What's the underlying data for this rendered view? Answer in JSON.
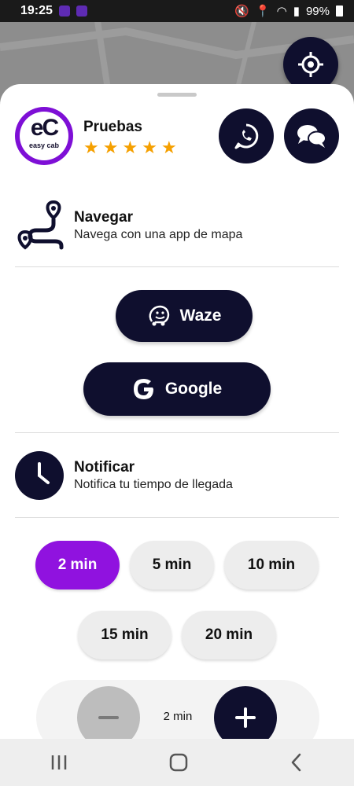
{
  "status_bar": {
    "time": "19:25",
    "battery": "99%"
  },
  "driver": {
    "name": "Pruebas",
    "rating": 5,
    "stars": [
      "★",
      "★",
      "★",
      "★",
      "★"
    ]
  },
  "logo": {
    "initials": "eC",
    "subtitle": "easy cab"
  },
  "navigate": {
    "title": "Navegar",
    "subtitle": "Navega con una app de mapa",
    "waze_label": "Waze",
    "google_label": "Google"
  },
  "notify": {
    "title": "Notificar",
    "subtitle": "Notifica tu tiempo de llegada",
    "options": [
      "2 min",
      "5 min",
      "10 min",
      "15 min",
      "20 min"
    ],
    "selected": "2 min"
  },
  "stepper": {
    "value": "2 min"
  },
  "icons": {
    "locate": "crosshair-icon",
    "whatsapp": "whatsapp-icon",
    "chat": "chat-bubbles-icon",
    "route": "route-icon",
    "waze": "waze-icon",
    "google": "google-icon",
    "clock": "clock-icon",
    "minus": "minus-icon",
    "plus": "plus-icon"
  },
  "colors": {
    "primary": "#0f0f2e",
    "accent": "#9012df",
    "star": "#f5a000",
    "chip": "#ededed"
  }
}
